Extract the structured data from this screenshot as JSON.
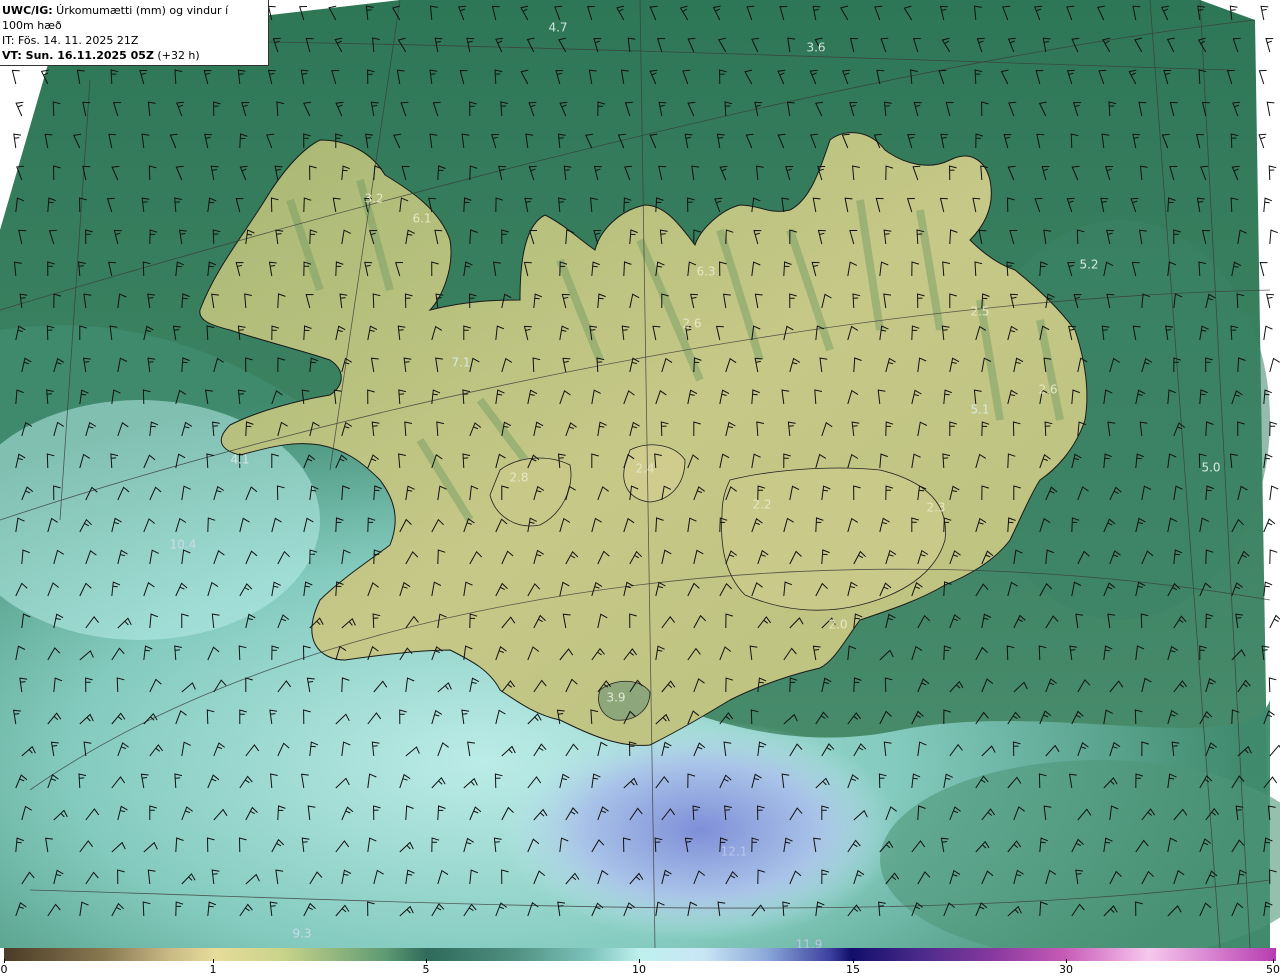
{
  "header": {
    "line1_bold": "UWC/IG:",
    "line1_rest": " Úrkomumætti (mm) og vindur í 100m hæð",
    "line2": "IT: Fös. 14. 11. 2025 21Z",
    "line3_bold": "VT: Sun. 16.11.2025 05Z",
    "line3_rest": " (+32 h)"
  },
  "map_labels": [
    {
      "text": "4.7",
      "color": "#cfe3dc"
    },
    {
      "text": "3.6",
      "color": "#cfe3dc"
    },
    {
      "text": "3.2",
      "color": "#e8e6c4"
    },
    {
      "text": "6.1",
      "color": "#e8e6c4"
    },
    {
      "text": "6.3",
      "color": "#e8e6c4"
    },
    {
      "text": "5.2",
      "color": "#d8e8e4"
    },
    {
      "text": "2.6",
      "color": "#e8e6c4"
    },
    {
      "text": "2.5",
      "color": "#e8e6c4"
    },
    {
      "text": "7.1",
      "color": "#d8e8e4"
    },
    {
      "text": "2.6",
      "color": "#e8e6c4"
    },
    {
      "text": "5.1",
      "color": "#d8e8e4"
    },
    {
      "text": "4.1",
      "color": "#d8e8e4"
    },
    {
      "text": "2.8",
      "color": "#e8e6c4"
    },
    {
      "text": "2.4",
      "color": "#e8e6c4"
    },
    {
      "text": "5.0",
      "color": "#d8e8e4"
    },
    {
      "text": "2.2",
      "color": "#e8e6c4"
    },
    {
      "text": "2.3",
      "color": "#e8e6c4"
    },
    {
      "text": "10.4",
      "color": "#c9d9e8"
    },
    {
      "text": "2.0",
      "color": "#e8e6c4"
    },
    {
      "text": "3.9",
      "color": "#e0ead8"
    },
    {
      "text": "12.1",
      "color": "#b9c6e8"
    },
    {
      "text": "9.3",
      "color": "#c9d9e8"
    },
    {
      "text": "11.9",
      "color": "#b9c6e8"
    }
  ],
  "colorbar": {
    "ticks": [
      "0",
      "1",
      "5",
      "10",
      "15",
      "30",
      "50"
    ]
  }
}
